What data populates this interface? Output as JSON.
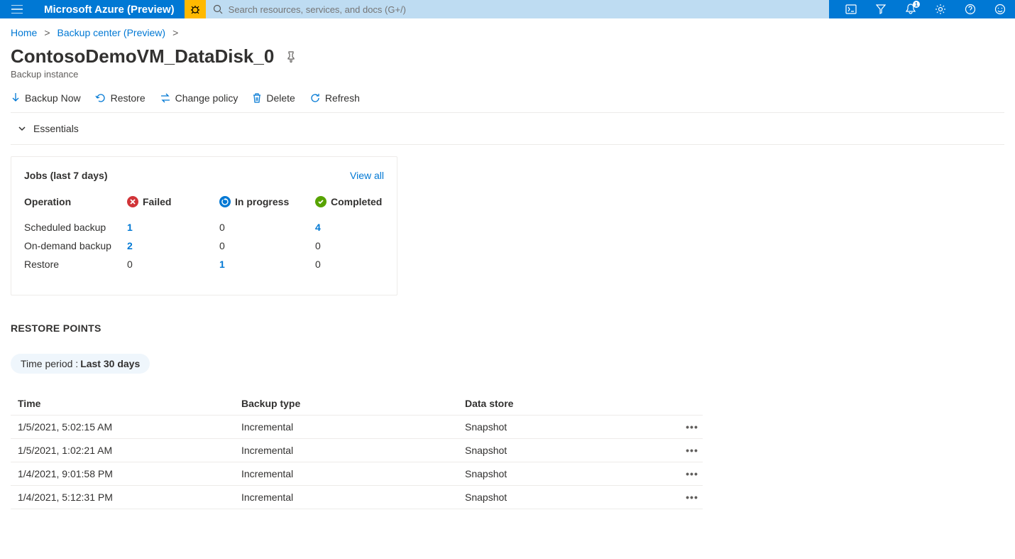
{
  "header": {
    "brand": "Microsoft Azure (Preview)",
    "search_placeholder": "Search resources, services, and docs (G+/)",
    "notification_count": "1"
  },
  "breadcrumb": {
    "home": "Home",
    "center": "Backup center (Preview)"
  },
  "page": {
    "title": "ContosoDemoVM_DataDisk_0",
    "subtitle": "Backup instance"
  },
  "toolbar": {
    "backup_now": "Backup Now",
    "restore": "Restore",
    "change_policy": "Change policy",
    "delete": "Delete",
    "refresh": "Refresh"
  },
  "essentials_label": "Essentials",
  "jobs": {
    "title": "Jobs (last 7 days)",
    "view_all": "View all",
    "columns": {
      "operation": "Operation",
      "failed": "Failed",
      "in_progress": "In progress",
      "completed": "Completed"
    },
    "rows": [
      {
        "op": "Scheduled backup",
        "failed": "1",
        "failed_link": true,
        "progress": "0",
        "progress_link": false,
        "completed": "4",
        "completed_link": true
      },
      {
        "op": "On-demand backup",
        "failed": "2",
        "failed_link": true,
        "progress": "0",
        "progress_link": false,
        "completed": "0",
        "completed_link": false
      },
      {
        "op": "Restore",
        "failed": "0",
        "failed_link": false,
        "progress": "1",
        "progress_link": true,
        "completed": "0",
        "completed_link": false
      }
    ]
  },
  "restore_points": {
    "title": "RESTORE POINTS",
    "time_period_label": "Time period : ",
    "time_period_value": "Last 30 days",
    "columns": {
      "time": "Time",
      "backup_type": "Backup type",
      "data_store": "Data store"
    },
    "rows": [
      {
        "time": "1/5/2021, 5:02:15 AM",
        "type": "Incremental",
        "store": "Snapshot"
      },
      {
        "time": "1/5/2021, 1:02:21 AM",
        "type": "Incremental",
        "store": "Snapshot"
      },
      {
        "time": "1/4/2021, 9:01:58 PM",
        "type": "Incremental",
        "store": "Snapshot"
      },
      {
        "time": "1/4/2021, 5:12:31 PM",
        "type": "Incremental",
        "store": "Snapshot"
      }
    ]
  }
}
